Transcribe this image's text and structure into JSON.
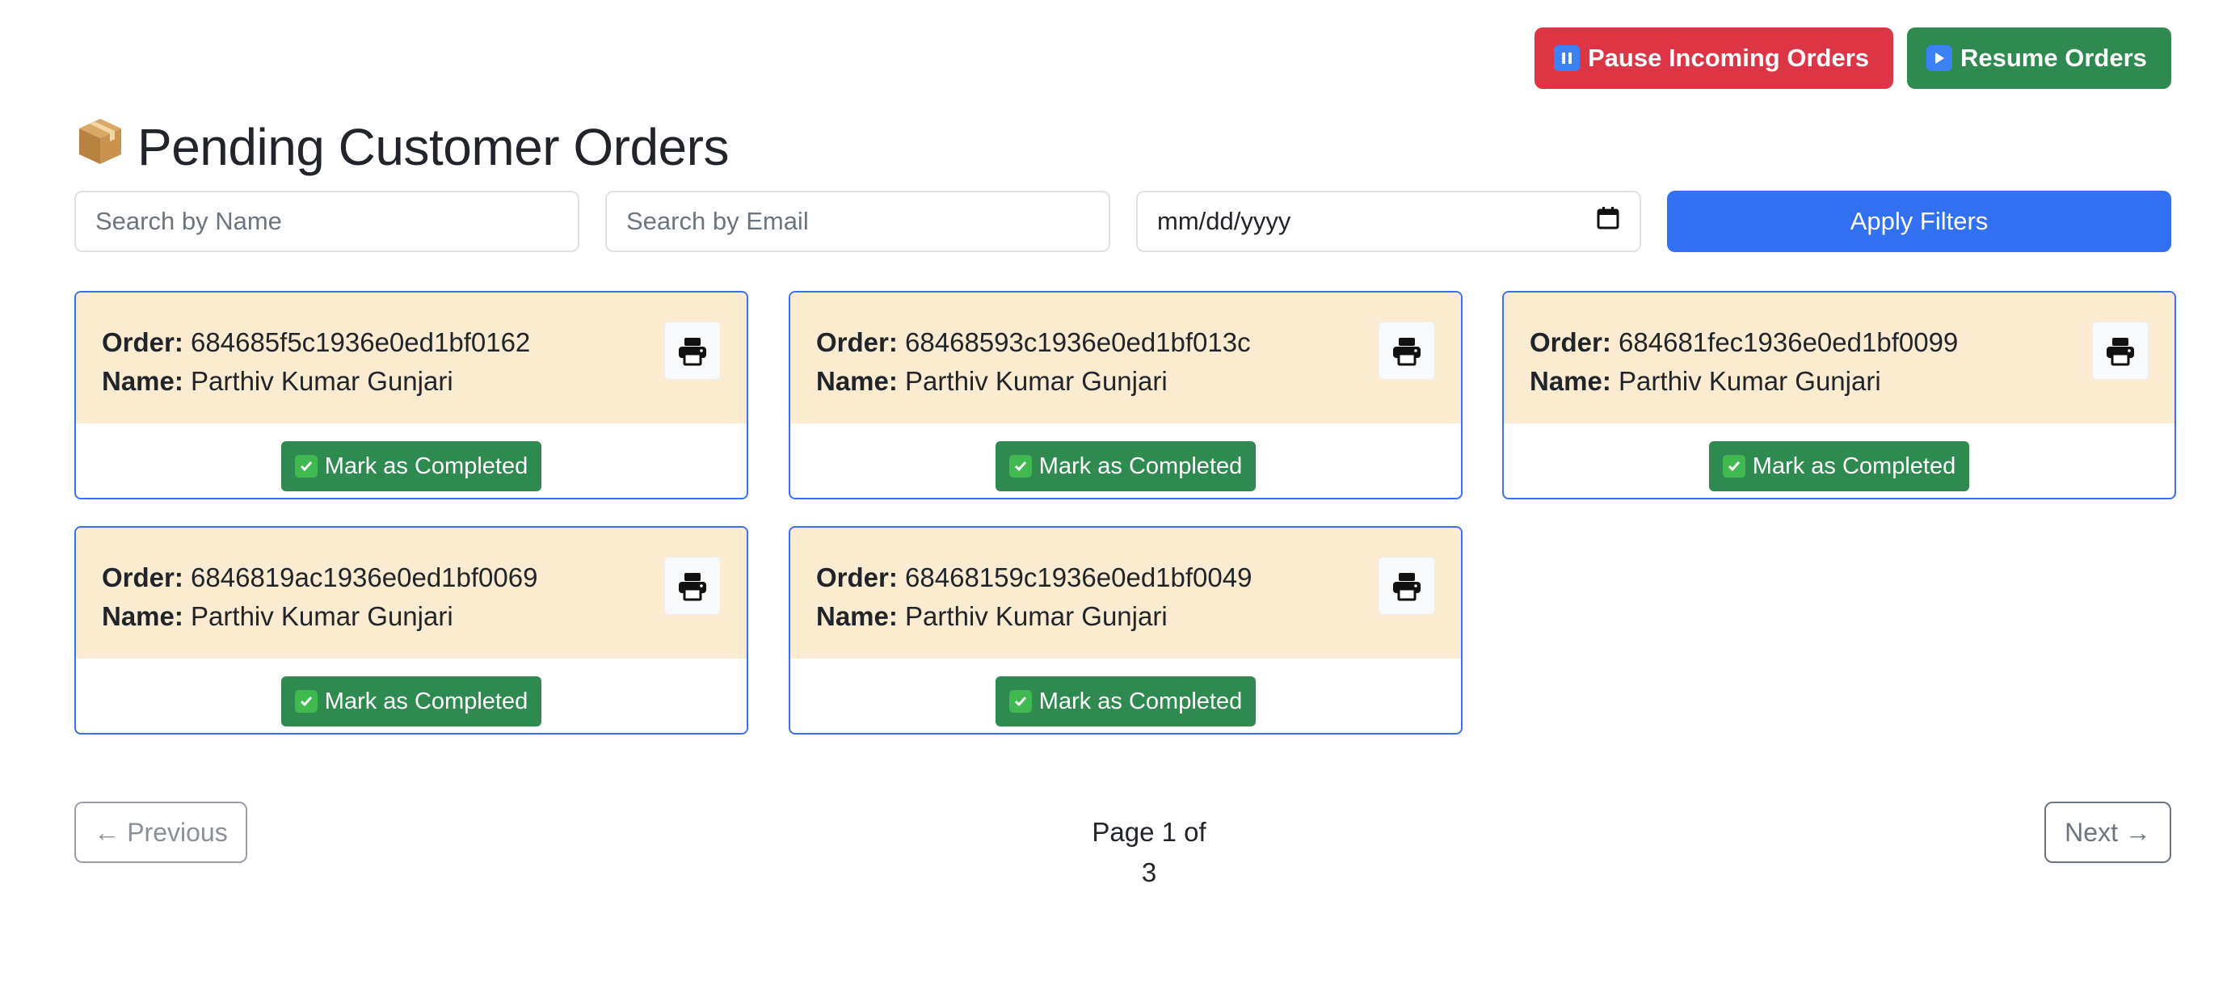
{
  "header": {
    "pause_label": "Pause Incoming Orders",
    "resume_label": "Resume Orders",
    "title": "Pending Customer Orders"
  },
  "filters": {
    "name_placeholder": "Search by Name",
    "email_placeholder": "Search by Email",
    "date_placeholder": "mm/dd/yyyy",
    "apply_label": "Apply Filters"
  },
  "labels": {
    "order": "Order:",
    "name": "Name:",
    "complete": "Mark as Completed"
  },
  "orders": [
    {
      "id": "684685f5c1936e0ed1bf0162",
      "name": "Parthiv Kumar Gunjari"
    },
    {
      "id": "68468593c1936e0ed1bf013c",
      "name": "Parthiv Kumar Gunjari"
    },
    {
      "id": "684681fec1936e0ed1bf0099",
      "name": "Parthiv Kumar Gunjari"
    },
    {
      "id": "6846819ac1936e0ed1bf0069",
      "name": "Parthiv Kumar Gunjari"
    },
    {
      "id": "68468159c1936e0ed1bf0049",
      "name": "Parthiv Kumar Gunjari"
    }
  ],
  "pagination": {
    "prev_label": "← Previous",
    "info": "Page 1 of 3",
    "next_label": "Next →"
  },
  "icons": {
    "pause": "pause-icon",
    "resume": "play-icon",
    "title": "package-icon",
    "print": "printer-icon",
    "check": "check-icon",
    "calendar": "calendar-icon"
  },
  "colors": {
    "danger": "#dc3545",
    "success": "#2f8a4f",
    "primary": "#3270f2",
    "card_header": "#fbebd1",
    "card_border": "#3b6ff0"
  }
}
